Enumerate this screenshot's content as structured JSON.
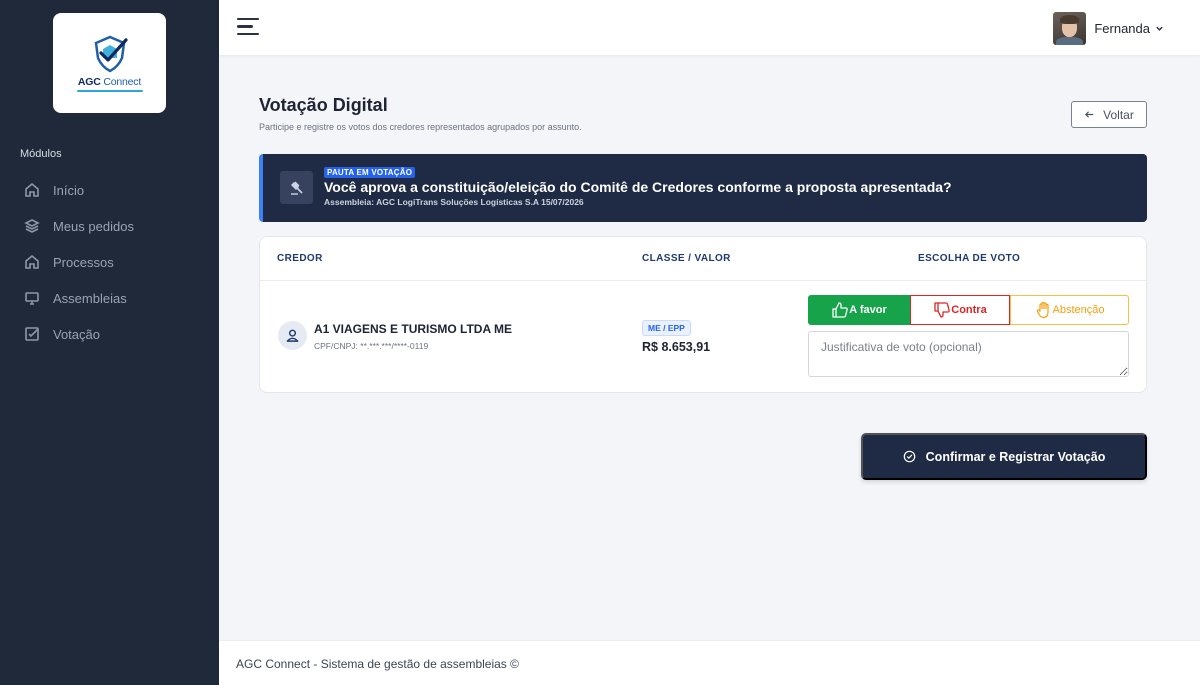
{
  "brand": {
    "name_bold": "AGC",
    "name_light": "Connect"
  },
  "sidebar": {
    "section_title": "Módulos",
    "items": [
      {
        "label": "Início",
        "icon": "home-icon"
      },
      {
        "label": "Meus pedidos",
        "icon": "layers-icon"
      },
      {
        "label": "Processos",
        "icon": "home-icon"
      },
      {
        "label": "Assembleias",
        "icon": "monitor-icon"
      },
      {
        "label": "Votação",
        "icon": "checkbox-icon"
      }
    ]
  },
  "header": {
    "user_name": "Fernanda"
  },
  "page": {
    "title": "Votação Digital",
    "subtitle": "Participe e registre os votos dos credores representados agrupados por assunto.",
    "back_label": "Voltar"
  },
  "pauta": {
    "badge": "PAUTA EM VOTAÇÃO",
    "question": "Você aprova a constituição/eleição do Comitê de Credores conforme a proposta apresentada?",
    "assembly": "Assembleia: AGC LogiTrans Soluções Logísticas S.A 15/07/2026"
  },
  "table": {
    "headers": {
      "credor": "CREDOR",
      "classe_valor": "CLASSE / VALOR",
      "escolha": "ESCOLHA DE VOTO"
    },
    "row": {
      "name": "A1 VIAGENS E TURISMO LTDA ME",
      "doc": "CPF/CNPJ: **.***.***/****-0119",
      "class": "ME / EPP",
      "value": "R$ 8.653,91",
      "selected_vote": "A favor"
    }
  },
  "votes": {
    "favor": "A favor",
    "contra": "Contra",
    "abstencao": "Abstenção"
  },
  "justification": {
    "placeholder": "Justificativa de voto (opcional)"
  },
  "confirm_label": "Confirmar e Registrar Votação",
  "footer": "AGC Connect - Sistema de gestão de assembleias ©",
  "colors": {
    "sidebar_bg": "#1f2939",
    "navy": "#1f2a44",
    "favor_green": "#16a34a",
    "contra_red": "#dc2626",
    "abstencao_amber": "#f59e0b",
    "accent_blue": "#2563eb"
  }
}
